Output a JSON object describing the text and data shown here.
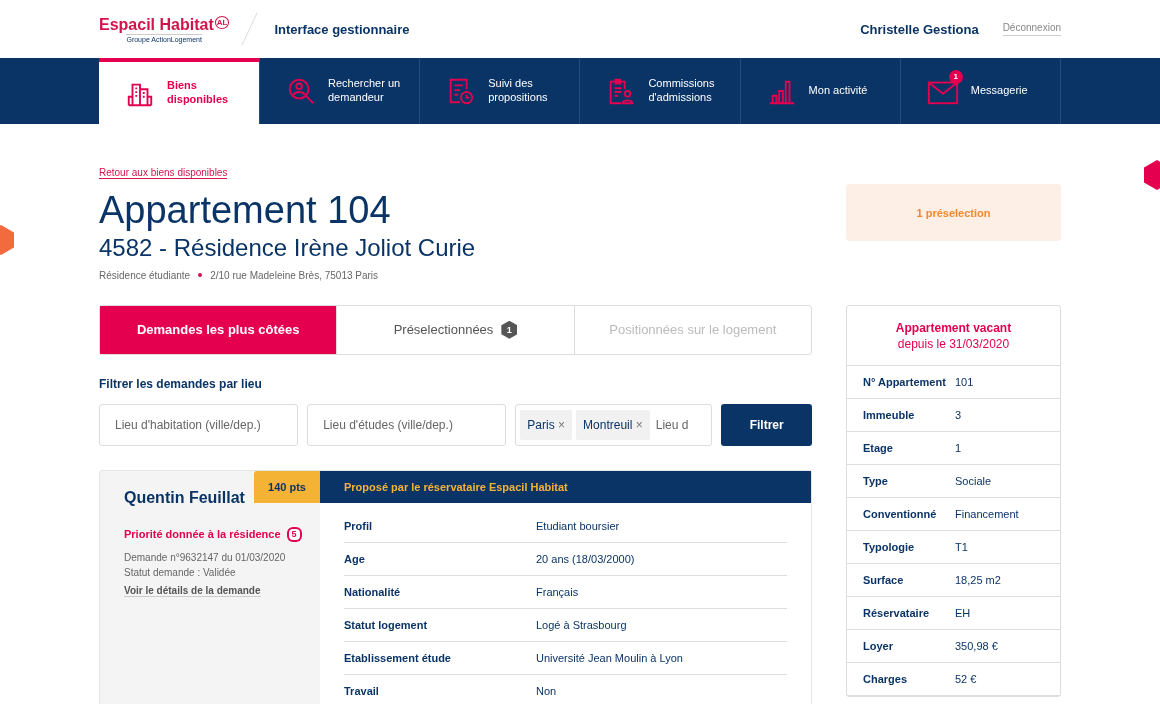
{
  "header": {
    "logo": {
      "name": "Espacil Habitat",
      "mark": "AL",
      "subtitle": "Groupe ActionLogement"
    },
    "app_title": "Interface gestionnaire",
    "user_name": "Christelle Gestiona",
    "logout": "Déconnexion"
  },
  "nav": [
    {
      "kind": "building",
      "label": "Biens disponibles",
      "selected": true
    },
    {
      "kind": "search-person",
      "label": "Rechercher un demandeur",
      "selected": false
    },
    {
      "kind": "document-clock",
      "label": "Suivi des propositions",
      "selected": false
    },
    {
      "kind": "clipboard-person",
      "label": "Commissions d'admissions",
      "selected": false
    },
    {
      "kind": "chart",
      "label": "Mon activité",
      "selected": false
    },
    {
      "kind": "mail",
      "label": "Messagerie",
      "selected": false,
      "badge": "1"
    }
  ],
  "back_link": "Retour aux biens disponibles",
  "title": "Appartement 104",
  "subtitle": "4582 - Résidence Irène Joliot Curie",
  "meta": {
    "type": "Résidence étudiante",
    "address": "2/10 rue Madeleine Brès, 75013 Paris"
  },
  "preselection_banner": "1 préselection",
  "tabs": [
    {
      "label": "Demandes les plus côtées",
      "selected": true,
      "disabled": false
    },
    {
      "label": "Préselectionnées",
      "selected": false,
      "disabled": false,
      "badge": "1"
    },
    {
      "label": "Positionnées sur le logement",
      "selected": false,
      "disabled": true
    }
  ],
  "filter": {
    "label": "Filtrer les demandes par lieu",
    "fields": [
      {
        "placeholder": "Lieu d'habitation (ville/dep.)"
      },
      {
        "placeholder": "Lieu d'études (ville/dep.)"
      }
    ],
    "tags": [
      "Paris",
      "Montreuil"
    ],
    "tag_remove": "×",
    "tag_placeholder": "Lieu d",
    "button": "Filtrer"
  },
  "applicant": {
    "name": "Quentin Feuillat",
    "points": "140 pts",
    "proposal": "Proposé par le réservataire Espacil Habitat",
    "priority": {
      "label": "Priorité donnée à la résidence",
      "count": "5"
    },
    "request": "Demande n°9632147 du 01/03/2020",
    "status": "Statut demande : Validée",
    "link": "Voir le détails de la demande",
    "details": [
      {
        "label": "Profil",
        "value": "Etudiant boursier"
      },
      {
        "label": "Age",
        "value": "20 ans (18/03/2000)"
      },
      {
        "label": "Nationalité",
        "value": "Français"
      },
      {
        "label": "Statut logement",
        "value": "Logé à Strasbourg"
      },
      {
        "label": "Etablissement étude",
        "value": "Université Jean Moulin à Lyon"
      },
      {
        "label": "Travail",
        "value": "Non"
      }
    ]
  },
  "vacancy": {
    "title": "Appartement vacant",
    "since": "depuis le 31/03/2020",
    "rows": [
      {
        "label": "N° Appartement",
        "value": "101"
      },
      {
        "label": "Immeuble",
        "value": "3"
      },
      {
        "label": "Etage",
        "value": "1"
      },
      {
        "label": "Type",
        "value": "Sociale"
      },
      {
        "label": "Conventionné",
        "value": "Financement"
      },
      {
        "label": "Typologie",
        "value": "T1"
      },
      {
        "label": "Surface",
        "value": "18,25 m2"
      },
      {
        "label": "Réservataire",
        "value": "EH"
      },
      {
        "label": "Loyer",
        "value": "350,98 €"
      },
      {
        "label": "Charges",
        "value": "52 €"
      }
    ]
  }
}
